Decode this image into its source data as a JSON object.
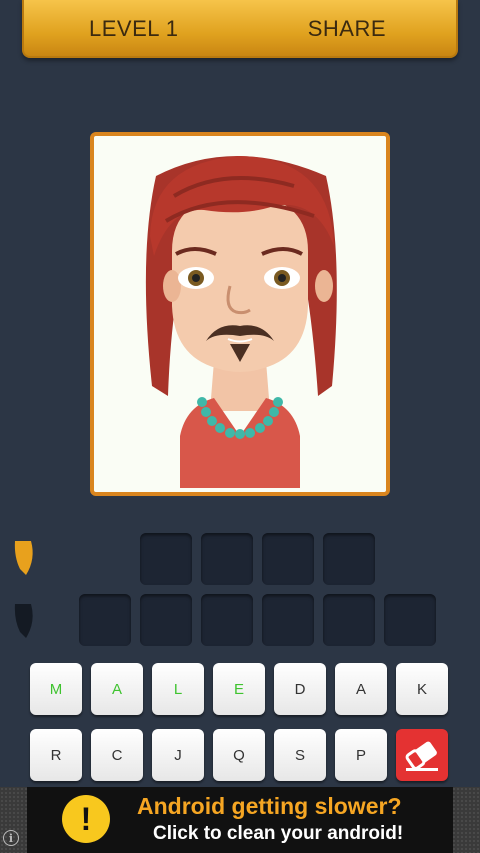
{
  "header": {
    "level_label": "LEVEL 1",
    "share_label": "SHARE"
  },
  "puzzle": {
    "image_description_icon": "cartoon-person-icon",
    "answer_row1_slots": 4,
    "answer_row2_slots": 6
  },
  "keyboard": {
    "row1": [
      {
        "letter": "M",
        "used": true
      },
      {
        "letter": "A",
        "used": true
      },
      {
        "letter": "L",
        "used": true
      },
      {
        "letter": "E",
        "used": true
      },
      {
        "letter": "D",
        "used": false
      },
      {
        "letter": "A",
        "used": false
      },
      {
        "letter": "K",
        "used": false
      }
    ],
    "row2": [
      {
        "letter": "R",
        "used": false
      },
      {
        "letter": "C",
        "used": false
      },
      {
        "letter": "J",
        "used": false
      },
      {
        "letter": "Q",
        "used": false
      },
      {
        "letter": "S",
        "used": false
      },
      {
        "letter": "P",
        "used": false
      }
    ],
    "erase_icon": "eraser-icon"
  },
  "ad": {
    "headline": "Android getting slower?",
    "subline": "Click to clean your android!",
    "badge_symbol": "!",
    "info_symbol": "i"
  },
  "colors": {
    "background": "#2c3645",
    "accent_gold": "#e0a21f",
    "used_letter": "#3fc32f",
    "erase_red": "#e43232",
    "ad_headline": "#f6a623"
  }
}
